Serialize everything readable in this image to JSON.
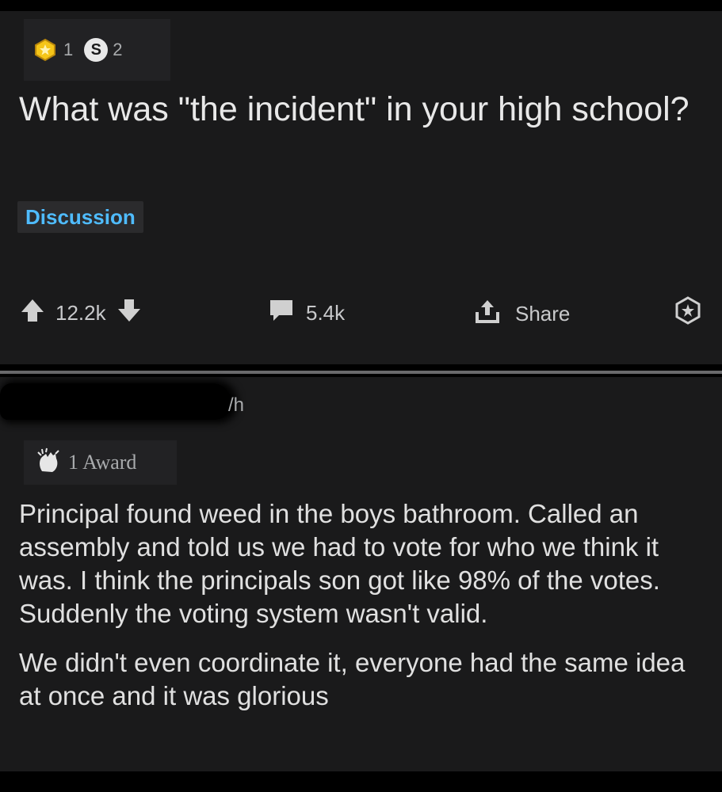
{
  "post": {
    "awards": [
      {
        "icon": "gold-award-icon",
        "count": "1"
      },
      {
        "icon": "silver-award-icon",
        "count": "2"
      }
    ],
    "silver_letter": "S",
    "title": "What was \"the incident\" in your high school?",
    "flair": "Discussion",
    "score": "12.2k",
    "comment_count": "5.4k",
    "share_label": "Share"
  },
  "comment": {
    "time_suffix": "/h",
    "award_label": "1 Award",
    "paragraphs": [
      "Principal found weed in the boys bathroom. Called an assembly and told us we had to vote for who we think it was. I think the principals son got like 98% of the votes. Suddenly the voting system wasn't valid.",
      "We didn't even coordinate it, everyone had the same idea at once and it was glorious"
    ]
  },
  "colors": {
    "background": "#1a1a1b",
    "text": "#d7dadc",
    "flair_text": "#4fbcff",
    "gold": "#f5c518"
  }
}
